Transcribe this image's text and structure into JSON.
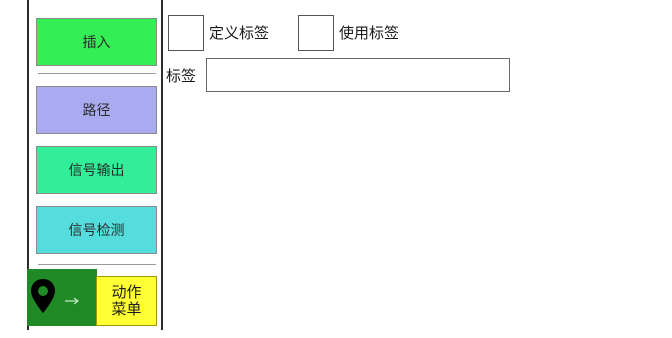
{
  "sidebar": {
    "buttons": [
      {
        "label": "插入",
        "color": "#33ee55"
      },
      {
        "label": "路径",
        "color": "#aaaaf0"
      },
      {
        "label": "信号输出",
        "color": "#33ee99"
      },
      {
        "label": "信号检测",
        "color": "#55dddd"
      }
    ],
    "pin_icon": "map-pin-icon",
    "arrow_icon": "arrow-right-icon",
    "tile_color": "#208a26",
    "action_menu": {
      "line1": "动作",
      "line2": "菜单",
      "color": "#ffff33"
    }
  },
  "form": {
    "define_tag_label": "定义标签",
    "use_tag_label": "使用标签",
    "tag_field_label": "标签",
    "tag_value": ""
  }
}
